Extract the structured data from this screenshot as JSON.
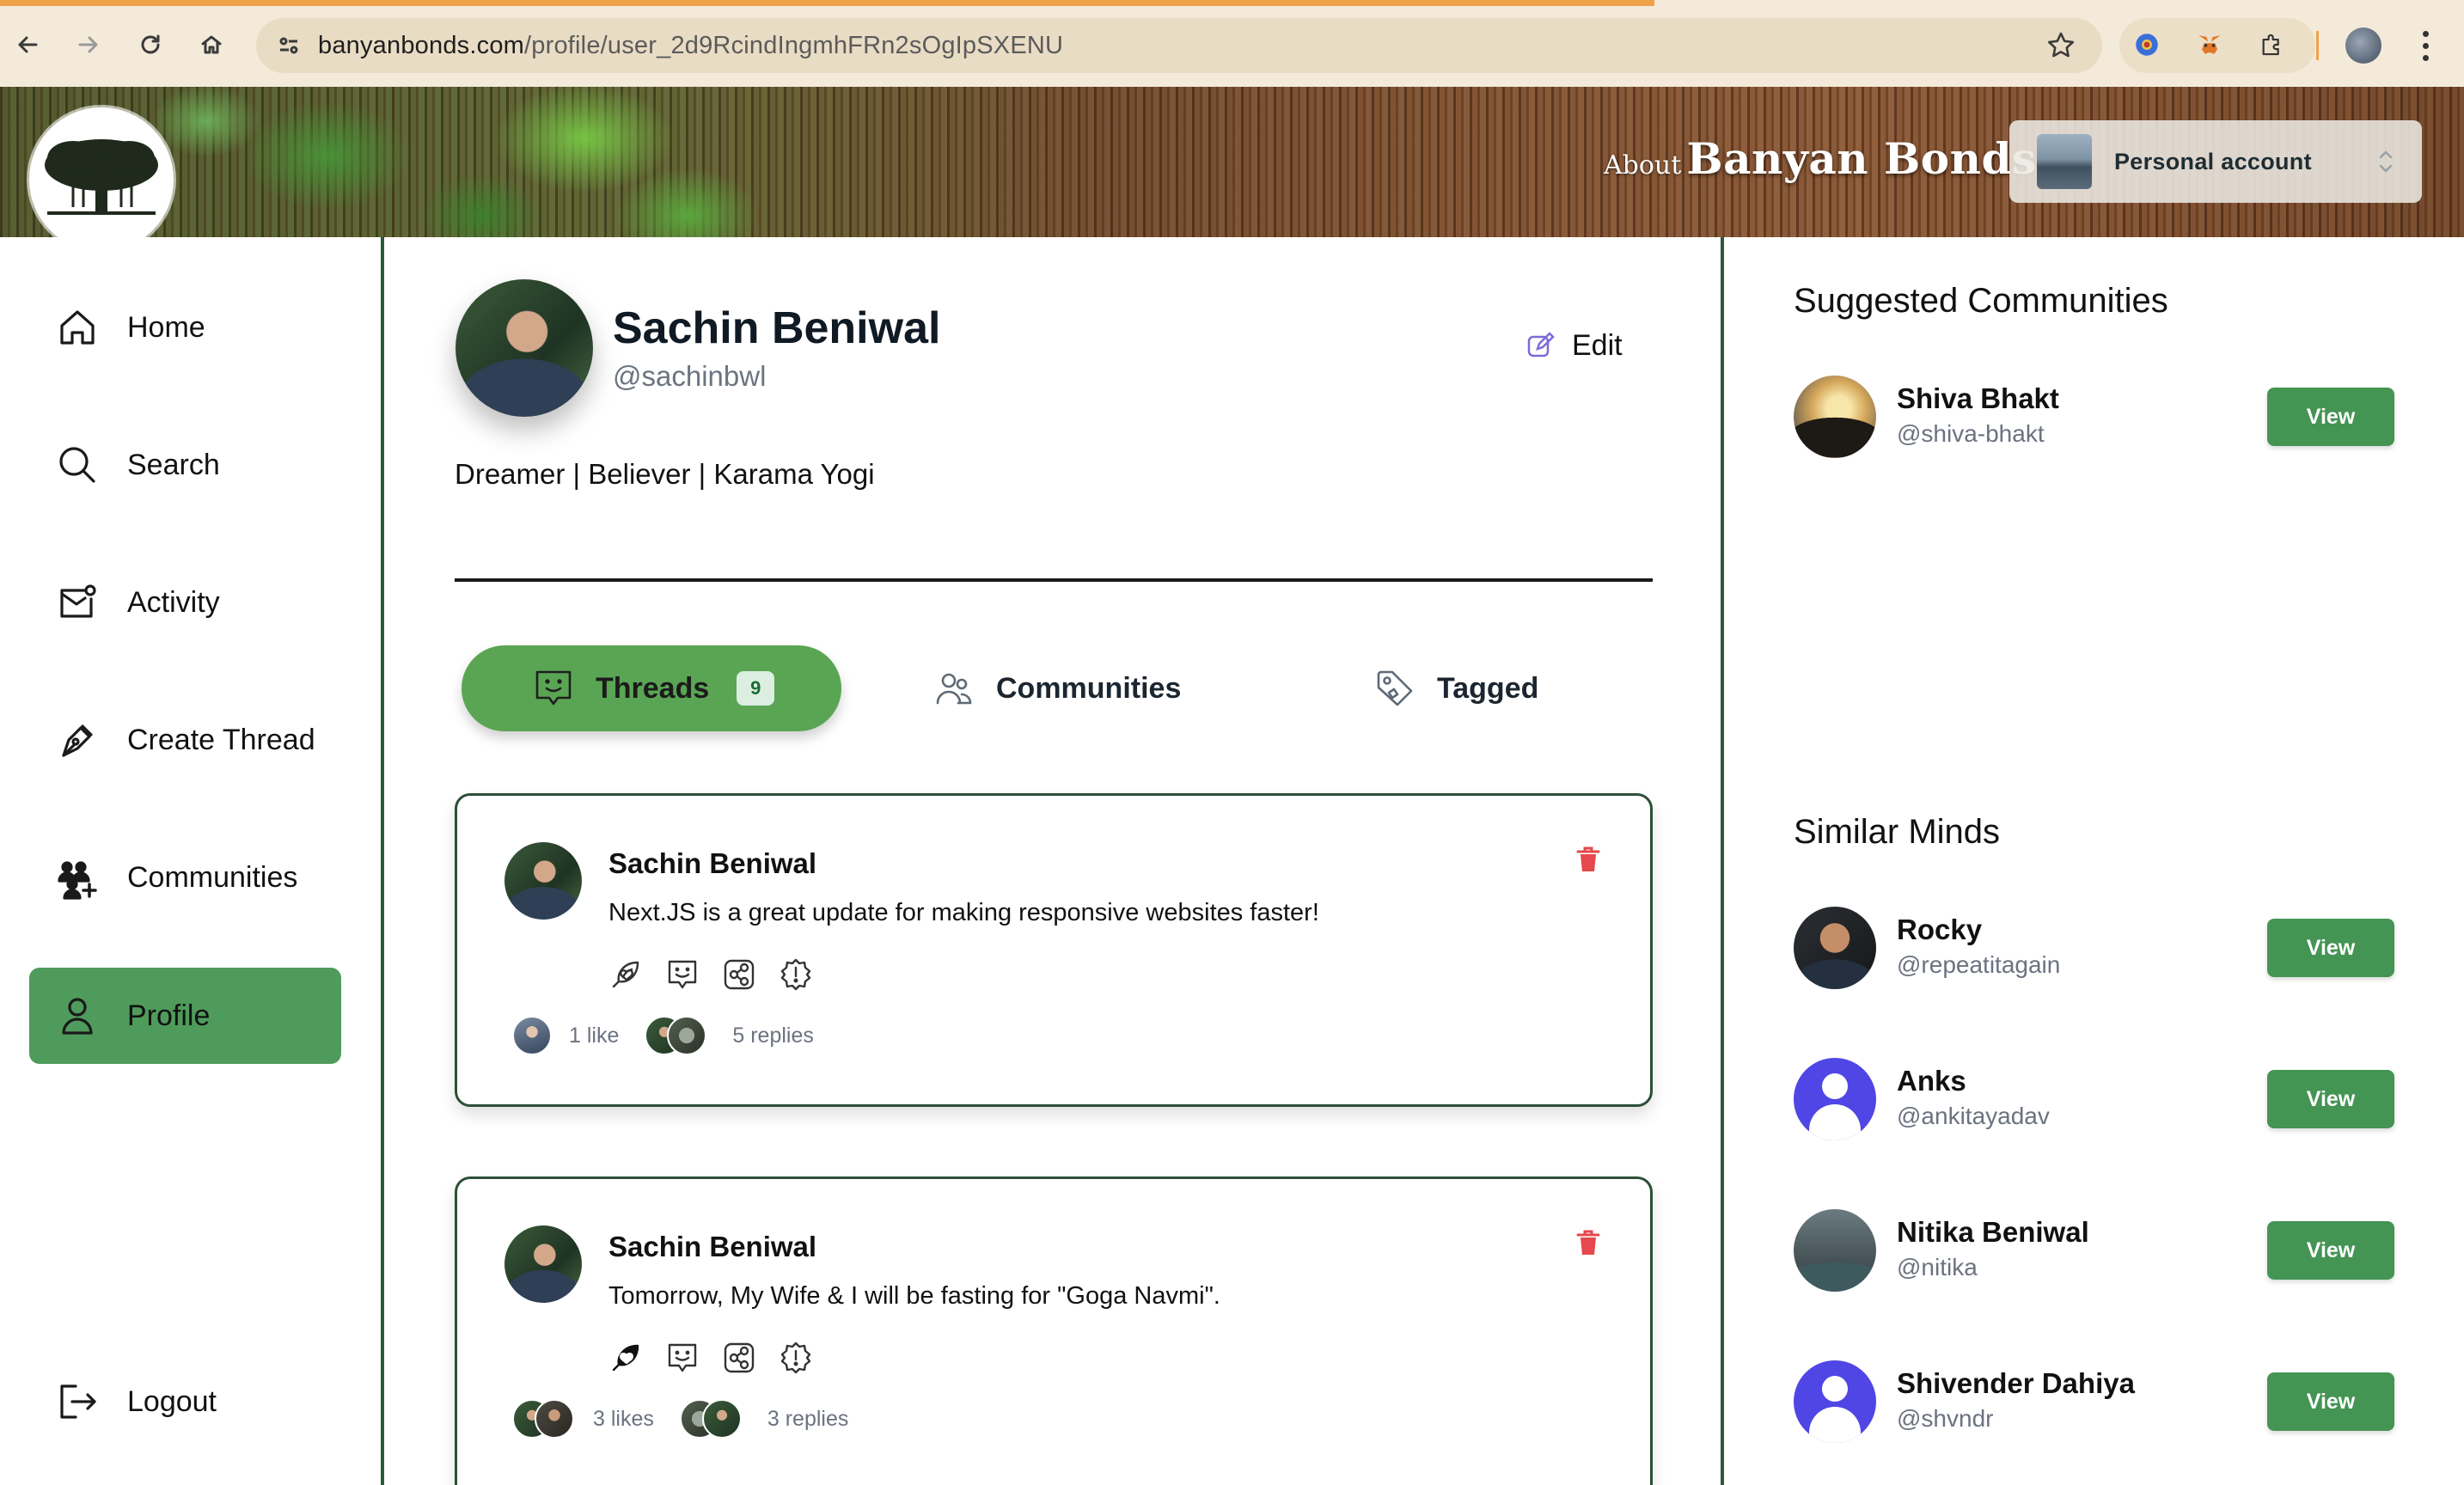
{
  "browser": {
    "url_host": "banyanbonds.com",
    "url_path": "/profile/user_2d9RcindIngmhFRn2sOgIpSXENU"
  },
  "header": {
    "about_label": "About",
    "brand_name": "Banyan Bonds",
    "account_switcher_label": "Personal account"
  },
  "sidebar": {
    "items": [
      {
        "label": "Home",
        "icon": "home-icon",
        "active": false
      },
      {
        "label": "Search",
        "icon": "search-icon",
        "active": false
      },
      {
        "label": "Activity",
        "icon": "activity-icon",
        "active": false
      },
      {
        "label": "Create Thread",
        "icon": "create-thread-icon",
        "active": false
      },
      {
        "label": "Communities",
        "icon": "communities-icon",
        "active": false
      },
      {
        "label": "Profile",
        "icon": "profile-icon",
        "active": true
      }
    ],
    "logout_label": "Logout"
  },
  "profile": {
    "name": "Sachin Beniwal",
    "handle": "@sachinbwl",
    "bio": "Dreamer | Believer | Karama Yogi",
    "edit_label": "Edit"
  },
  "tabs": [
    {
      "label": "Threads",
      "count": "9",
      "active": true
    },
    {
      "label": "Communities",
      "active": false
    },
    {
      "label": "Tagged",
      "active": false
    }
  ],
  "threads": [
    {
      "author": "Sachin Beniwal",
      "text": "Next.JS is a great update for making responsive websites faster!",
      "likes": "1 like",
      "replies": "5 replies",
      "liked": false
    },
    {
      "author": "Sachin Beniwal",
      "text": "Tomorrow, My Wife & I will be fasting for \"Goga Navmi\".",
      "likes": "3 likes",
      "replies": "3 replies",
      "liked": true
    }
  ],
  "suggested_communities": {
    "title": "Suggested Communities",
    "items": [
      {
        "name": "Shiva Bhakt",
        "handle": "@shiva-bhakt",
        "button": "View"
      }
    ]
  },
  "similar_minds": {
    "title": "Similar Minds",
    "items": [
      {
        "name": "Rocky",
        "handle": "@repeatitagain",
        "button": "View"
      },
      {
        "name": "Anks",
        "handle": "@ankitayadav",
        "button": "View"
      },
      {
        "name": "Nitika Beniwal",
        "handle": "@nitika",
        "button": "View"
      },
      {
        "name": "Shivender Dahiya",
        "handle": "@shvndr",
        "button": "View"
      }
    ]
  },
  "colors": {
    "primary_green": "#4f9b5b",
    "button_green": "#449454",
    "divider": "#2b5a3b",
    "delete_red": "#e5484d"
  }
}
